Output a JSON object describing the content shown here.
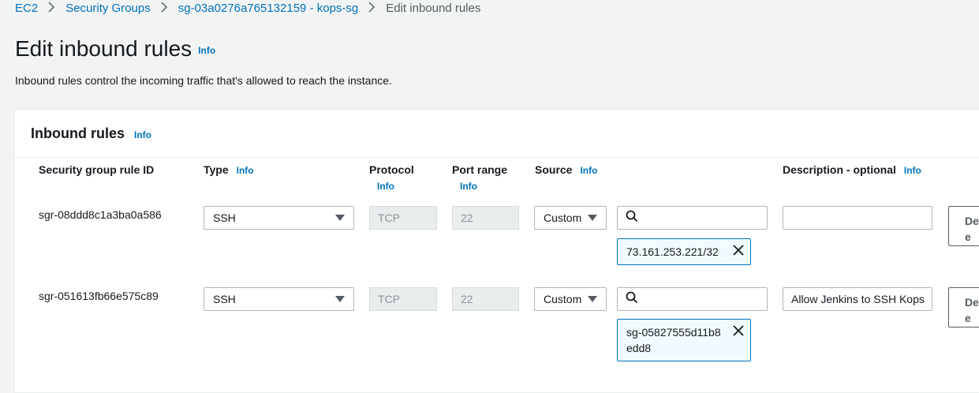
{
  "breadcrumb": {
    "items": [
      "EC2",
      "Security Groups",
      "sg-03a0276a765132159 - kops-sg"
    ],
    "current": "Edit inbound rules"
  },
  "page": {
    "title": "Edit inbound rules",
    "info": "Info",
    "description": "Inbound rules control the incoming traffic that's allowed to reach the instance."
  },
  "panel": {
    "title": "Inbound rules",
    "info": "Info",
    "columns": {
      "rule_id": "Security group rule ID",
      "type": "Type",
      "protocol": "Protocol",
      "port_range": "Port range",
      "source": "Source",
      "description": "Description - optional",
      "info": "Info"
    }
  },
  "rules": [
    {
      "id": "sgr-08ddd8c1a3ba0a586",
      "type": "SSH",
      "protocol": "TCP",
      "port": "22",
      "source": "Custom",
      "search_value": "",
      "token": "73.161.253.221/32",
      "description": "",
      "delete_label": "De\ne"
    },
    {
      "id": "sgr-051613fb66e575c89",
      "type": "SSH",
      "protocol": "TCP",
      "port": "22",
      "source": "Custom",
      "search_value": "",
      "token": "sg-05827555d11b8edd8",
      "description": "Allow Jenkins to SSH Kops",
      "delete_label": "De\ne"
    }
  ]
}
